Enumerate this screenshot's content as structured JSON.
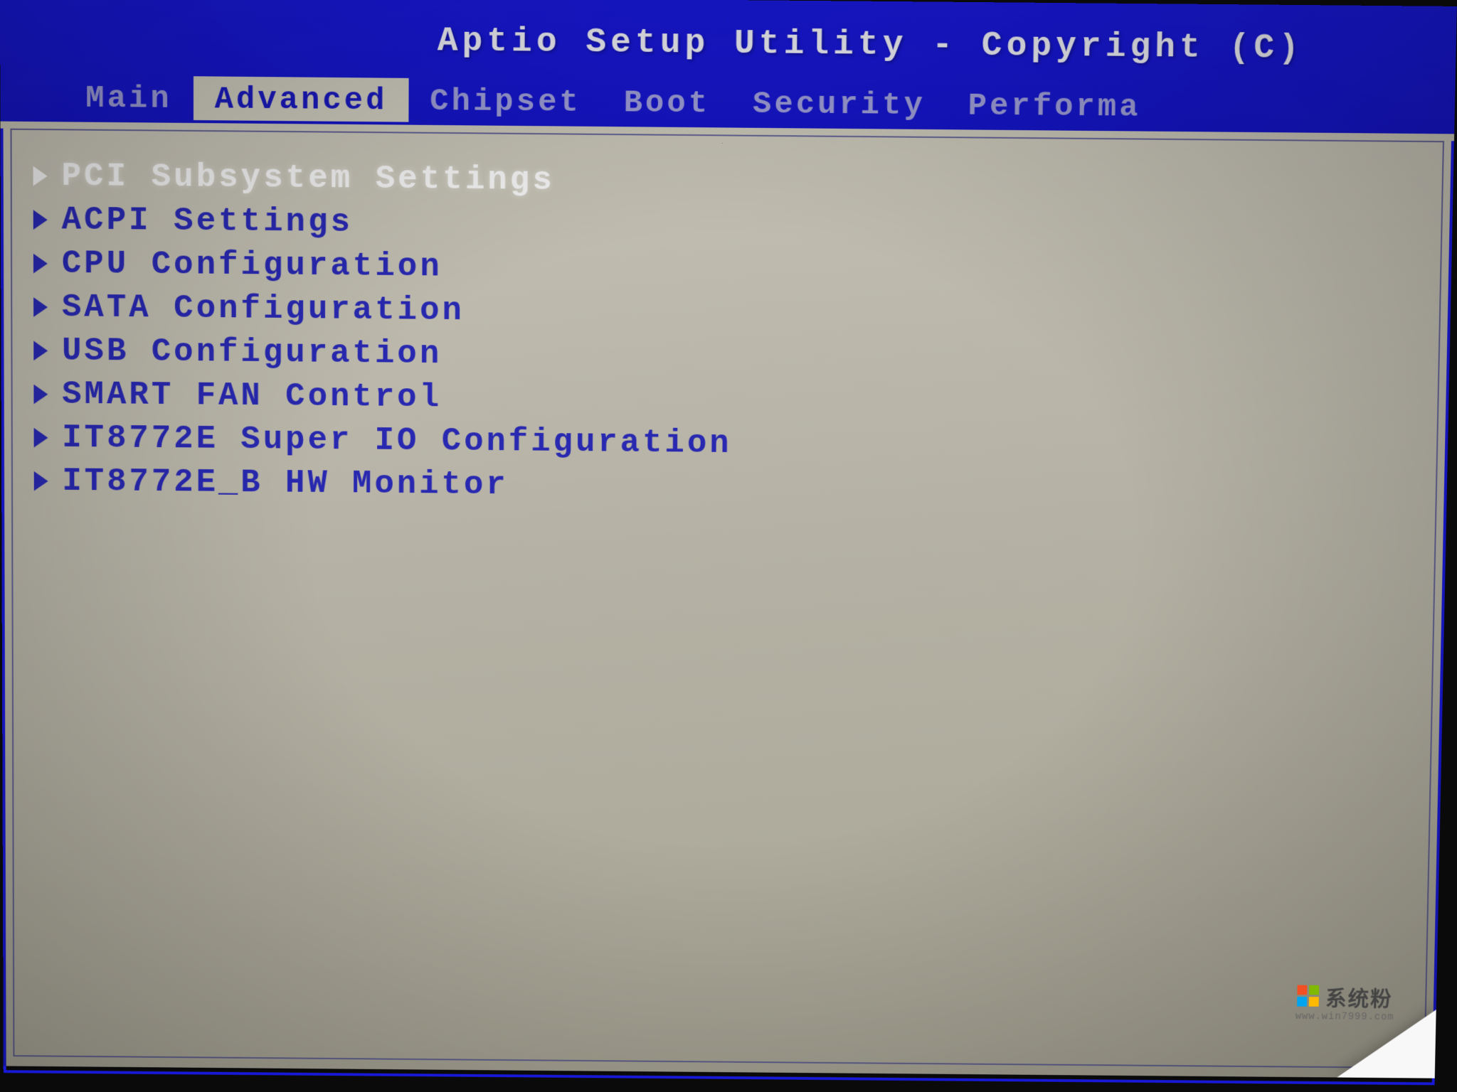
{
  "header": {
    "title": "Aptio Setup Utility - Copyright (C)"
  },
  "tabs": [
    {
      "label": "Main",
      "active": false
    },
    {
      "label": "Advanced",
      "active": true
    },
    {
      "label": "Chipset",
      "active": false
    },
    {
      "label": "Boot",
      "active": false
    },
    {
      "label": "Security",
      "active": false
    },
    {
      "label": "Performa",
      "active": false
    }
  ],
  "menu": {
    "items": [
      {
        "label": "PCI Subsystem Settings",
        "selected": true
      },
      {
        "label": "ACPI Settings",
        "selected": false
      },
      {
        "label": "CPU Configuration",
        "selected": false
      },
      {
        "label": "SATA Configuration",
        "selected": false
      },
      {
        "label": "USB Configuration",
        "selected": false
      },
      {
        "label": "SMART FAN Control",
        "selected": false
      },
      {
        "label": "IT8772E Super IO Configuration",
        "selected": false
      },
      {
        "label": "IT8772E_B HW Monitor",
        "selected": false
      }
    ]
  },
  "watermark": {
    "text": "系统粉",
    "url": "www.win7999.com"
  }
}
